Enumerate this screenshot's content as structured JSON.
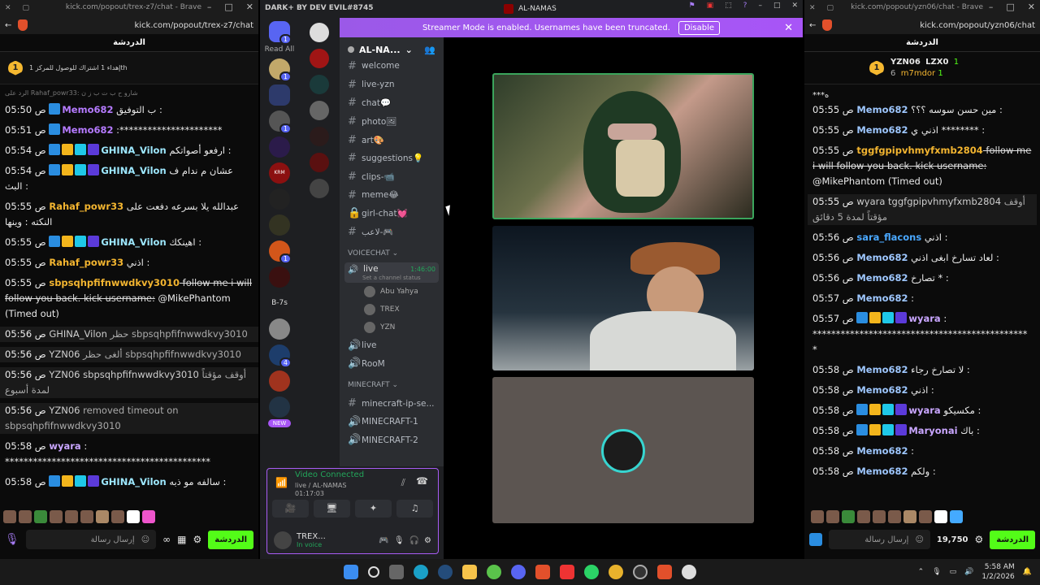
{
  "left_chat": {
    "window_title": "kick.com/popout/trex-z7/chat - Brave",
    "url": "kick.com/popout/trex-z7/chat",
    "header": "الدردشة",
    "pinned_badge": "1",
    "pinned_text": "إهداء 1 اشتراك للوصول للمركز 1th",
    "reply_hint": "الرد على Rahaf_powr33: شارو ح ب ت ب ز ن",
    "messages": [
      {
        "time": "05:50 ص",
        "user": "Memo682",
        "user_color": "#b57bff",
        "text": "ب التوفيق :",
        "badges": 1
      },
      {
        "time": "05:51 ص",
        "user": "Memo682",
        "user_color": "#b57bff",
        "text": ":**********************",
        "badges": 1
      },
      {
        "time": "05:54 ص",
        "user": "GHINA_Vilon",
        "user_color": "#9ee8ff",
        "text": "ارفعو أصواتكم :",
        "badges": 4
      },
      {
        "time": "05:54 ص",
        "user": "GHINA_Vilon",
        "user_color": "#9ee8ff",
        "text": "عشان م ندام ف البث :",
        "badges": 4
      },
      {
        "time": "05:55 ص",
        "user": "Rahaf_powr33",
        "user_color": "#f3b530",
        "text": "عبدالله يلا بسرعه دفعت على النكته : وينها",
        "badges": 0
      },
      {
        "time": "05:55 ص",
        "user": "GHINA_Vilon",
        "user_color": "#9ee8ff",
        "text": "اهينكك :",
        "badges": 4
      },
      {
        "time": "05:55 ص",
        "user": "Rahaf_powr33",
        "user_color": "#f3b530",
        "text": "اذني :",
        "badges": 0
      },
      {
        "time": "05:55 ص",
        "user": "sbpsqhpfifnwwdkvy3010",
        "user_color": "#f3b530",
        "text": "follow me i will follow you back. kick username:",
        "extra": "@MikePhantom (Timed out)",
        "badges": 0,
        "strike": true
      },
      {
        "time": "05:56 ص",
        "user": "GHINA_Vilon",
        "user_color": "#cfcfcf",
        "text": "حظر sbpsqhpfifnwwdkvy3010",
        "badges": 0,
        "system": true
      },
      {
        "time": "05:56 ص",
        "user": "YZN06",
        "user_color": "#cfcfcf",
        "text": "ألغى حظر sbpsqhpfifnwwdkvy3010",
        "badges": 0,
        "system": true
      },
      {
        "time": "05:56 ص",
        "user": "YZN06 sbpsqhpfifnwwdkvy3010",
        "user_color": "#cfcfcf",
        "text": "أوقف مؤقتاً لمدة أسبوع",
        "badges": 0,
        "system": true
      },
      {
        "time": "05:56 ص",
        "user": "YZN06",
        "user_color": "#cfcfcf",
        "text": "removed timeout on sbpsqhpfifnwwdkvy3010",
        "badges": 0,
        "system": true
      },
      {
        "time": "05:58 ص",
        "user": "wyara",
        "user_color": "#c9a6ff",
        "text": ": ********************************************",
        "badges": 0
      },
      {
        "time": "05:58 ص",
        "user": "GHINA_Vilon",
        "user_color": "#9ee8ff",
        "text": "سالفه مو ذبه :",
        "badges": 4
      }
    ],
    "input_placeholder": "إرسال رسالة",
    "chat_button": "الدردشة"
  },
  "discord": {
    "app_title": "DARK+ BY DEV EVIL#8745",
    "server_title": "AL-NAMAS",
    "read_all": "Read All",
    "read_all_badge": "1",
    "banner_text": "Streamer Mode is enabled. Usernames have been truncated.",
    "banner_button": "Disable",
    "guild_name": "AL-NA...",
    "channels": [
      {
        "name": "welcome",
        "icon": "#"
      },
      {
        "name": "live-yzn",
        "icon": "#"
      },
      {
        "name": "chat💬",
        "icon": "#"
      },
      {
        "name": "photo🖼",
        "icon": "#"
      },
      {
        "name": "art🎨",
        "icon": "#"
      },
      {
        "name": "suggestions💡",
        "icon": "#"
      },
      {
        "name": "clips-📹",
        "icon": "#"
      },
      {
        "name": "meme😂",
        "icon": "#"
      },
      {
        "name": "girl-chat💓",
        "icon": "🔒"
      },
      {
        "name": "لاعب-🎮",
        "icon": "#"
      }
    ],
    "voice_category": "VOICECHAT",
    "voice_channel": {
      "name": "live",
      "time": "1:46:00",
      "status": "Set a channel status"
    },
    "voice_users": [
      "Abu Yahya",
      "TREX",
      "YZN"
    ],
    "voice_channels_more": [
      "live",
      "RooM"
    ],
    "mc_category": "MINECRAFT",
    "mc_channels": [
      "minecraft-ip-se...",
      "MINECRAFT-1",
      "MINECRAFT-2"
    ],
    "new_badge": "NEW",
    "server_labels": [
      "B-7s",
      "KRM"
    ],
    "voice_panel": {
      "status": "Video Connected",
      "channel": "live / AL-NAMAS",
      "elapsed": "01:17:03",
      "user": "TREX...",
      "user_status": "In voice"
    }
  },
  "right_chat": {
    "window_title": "kick.com/popout/yzn06/chat - Brave",
    "url": "kick.com/popout/yzn06/chat",
    "header": "الدردشة",
    "leaders": [
      {
        "name": "YZN06",
        "count": "1",
        "rank": "6"
      },
      {
        "name": "LZX0",
        "count": "1"
      },
      {
        "name": "m7mdor",
        "count": "1"
      }
    ],
    "top_line": "***ه",
    "messages": [
      {
        "time": "05:55 ص",
        "user": "Memo682",
        "user_color": "#9ec7ff",
        "text": "مين حسن سوسه ؟؟؟ :"
      },
      {
        "time": "05:55 ص",
        "user": "Memo682",
        "user_color": "#9ec7ff",
        "text": "اذني ي ******** :"
      },
      {
        "time": "05:55 ص",
        "user": "tggfgpipvhmyfxmb2804",
        "user_color": "#f3b530",
        "text": "follow me i will follow you back. kick username:",
        "extra": "@MikePhantom (Timed out)",
        "strike": true
      },
      {
        "time": "05:55 ص",
        "user": "wyara tggfgpipvhmyfxmb2804",
        "user_color": "#cfcfcf",
        "text": "أوقف مؤقتاً لمدة 5 دقائق",
        "system": true
      },
      {
        "time": "05:56 ص",
        "user": "sara_flacons",
        "user_color": "#4aa8ff",
        "text": "اذني :"
      },
      {
        "time": "05:56 ص",
        "user": "Memo682",
        "user_color": "#9ec7ff",
        "text": "لعاد تسارخ ابغى اذني :"
      },
      {
        "time": "05:56 ص",
        "user": "Memo682",
        "user_color": "#9ec7ff",
        "text": "تصارخ * :"
      },
      {
        "time": "05:57 ص",
        "user": "Memo682",
        "user_color": "#9ec7ff",
        "text": ":"
      },
      {
        "time": "05:57 ص",
        "user": "wyara",
        "user_color": "#c9a6ff",
        "text": ": ***********************************************",
        "badges": 4
      },
      {
        "time": "05:58 ص",
        "user": "Memo682",
        "user_color": "#9ec7ff",
        "text": "لا تصارخ رجاء :"
      },
      {
        "time": "05:58 ص",
        "user": "Memo682",
        "user_color": "#9ec7ff",
        "text": "اذني :"
      },
      {
        "time": "05:58 ص",
        "user": "wyara",
        "user_color": "#c9a6ff",
        "text": "مكسيكو :",
        "badges": 4
      },
      {
        "time": "05:58 ص",
        "user": "Maryonai",
        "user_color": "#c9a6ff",
        "text": "باك :",
        "badges": 4
      },
      {
        "time": "05:58 ص",
        "user": "Memo682",
        "user_color": "#9ec7ff",
        "text": ":"
      },
      {
        "time": "05:58 ص",
        "user": "Memo682",
        "user_color": "#9ec7ff",
        "text": "ولكم :"
      }
    ],
    "input_placeholder": "إرسال رسالة",
    "points": "19,750",
    "chat_button": "الدردشة"
  },
  "taskbar": {
    "time": "5:58 AM",
    "date": "1/2/2026",
    "apps": [
      "start-icon",
      "search-icon",
      "task-view-icon",
      "edge-icon",
      "steam-icon",
      "explorer-icon",
      "xbox-icon",
      "discord-icon",
      "brave-icon",
      "youtube-icon",
      "whatsapp-icon",
      "chrome-icon",
      "obs-icon",
      "brave-beta-icon",
      "app-icon"
    ]
  }
}
